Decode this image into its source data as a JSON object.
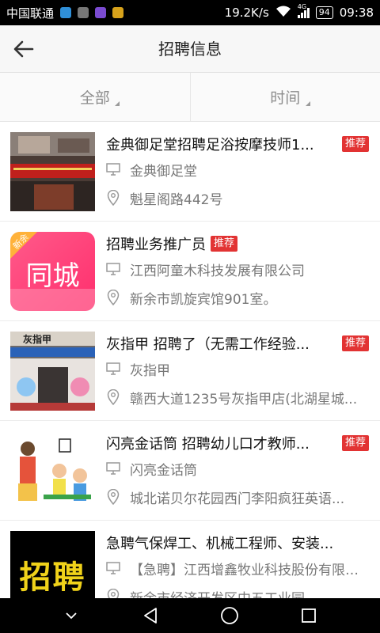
{
  "status_bar": {
    "carrier": "中国联通",
    "speed": "19.2K/s",
    "network": "4G",
    "battery": "94",
    "time": "09:38"
  },
  "header": {
    "title": "招聘信息"
  },
  "filters": [
    {
      "label": "全部"
    },
    {
      "label": "时间"
    }
  ],
  "jobs": [
    {
      "title": "金典御足堂招聘足浴按摩技师1...",
      "badge": "推荐",
      "company": "金典御足堂",
      "address": "魁星阁路442号"
    },
    {
      "title": "招聘业务推广员",
      "badge": "推荐",
      "company": "江西阿童木科技发展有限公司",
      "address": "新余市凯旋宾馆901室。",
      "thumb_text": "同城",
      "thumb_corner": "新余"
    },
    {
      "title": "灰指甲 招聘了（无需工作经验...",
      "badge": "推荐",
      "company": "灰指甲",
      "address": "赣西大道1235号灰指甲店(北湖星城...",
      "thumb_text": "灰指甲"
    },
    {
      "title": "闪亮金话筒 招聘幼儿口才教师...",
      "badge": "推荐",
      "company": "闪亮金话筒",
      "address": "城北诺贝尔花园西门李阳疯狂英语..."
    },
    {
      "title": "急聘气保焊工、机械工程师、安装...",
      "badge": "",
      "company": "【急聘】江西增鑫牧业科技股份有限公...",
      "address": "新余市经济开发区中五工业园",
      "thumb_text": "招聘"
    }
  ]
}
